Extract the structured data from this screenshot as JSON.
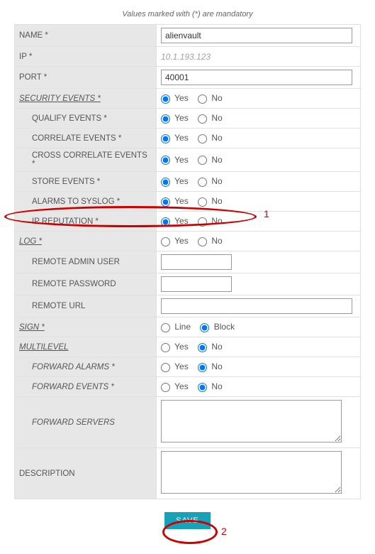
{
  "note": "Values marked with (*) are mandatory",
  "labels": {
    "name": "NAME *",
    "ip": "IP *",
    "port": "PORT *",
    "security_events": "SECURITY EVENTS *",
    "qualify_events": "QUALIFY EVENTS *",
    "correlate_events": "CORRELATE EVENTS *",
    "cross_correlate_events": "CROSS CORRELATE EVENTS *",
    "store_events": "STORE EVENTS *",
    "alarms_to_syslog": "ALARMS TO SYSLOG *",
    "ip_reputation": "IP REPUTATION *",
    "log": "LOG  *",
    "remote_admin_user": "REMOTE ADMIN USER",
    "remote_password": "REMOTE PASSWORD",
    "remote_url": "REMOTE URL",
    "sign": "SIGN  *",
    "multilevel": "MULTILEVEL",
    "forward_alarms": "FORWARD ALARMS  *",
    "forward_events": "FORWARD EVENTS  *",
    "forward_servers": "FORWARD SERVERS",
    "description": "DESCRIPTION"
  },
  "values": {
    "name": "alienvault",
    "ip": "10.1.193.123",
    "port": "40001",
    "remote_admin_user": "",
    "remote_password": "",
    "remote_url": "",
    "forward_servers": "",
    "description": ""
  },
  "opts": {
    "yes": "Yes",
    "no": "No",
    "line": "Line",
    "block": "Block"
  },
  "radios": {
    "security_events": "yes",
    "qualify_events": "yes",
    "correlate_events": "yes",
    "cross_correlate_events": "yes",
    "store_events": "yes",
    "alarms_to_syslog": "yes",
    "ip_reputation": "yes",
    "log": "",
    "sign": "block",
    "multilevel": "no",
    "forward_alarms": "no",
    "forward_events": "no"
  },
  "buttons": {
    "save": "SAVE"
  },
  "annotations": {
    "one": "1",
    "two": "2"
  }
}
